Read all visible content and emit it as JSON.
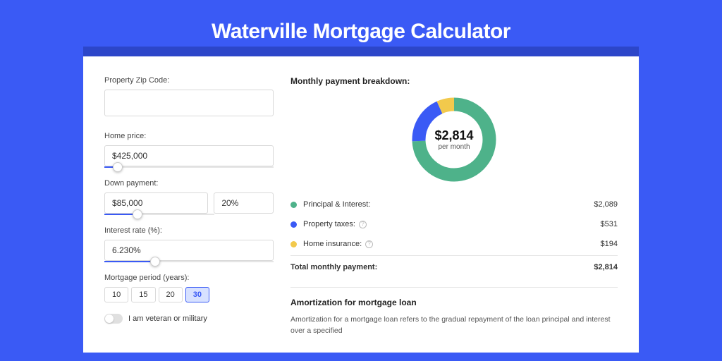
{
  "page": {
    "title": "Waterville Mortgage Calculator"
  },
  "form": {
    "zip": {
      "label": "Property Zip Code:",
      "value": ""
    },
    "home_price": {
      "label": "Home price:",
      "value": "$425,000",
      "slider_pct": 8
    },
    "down_payment": {
      "label": "Down payment:",
      "amount": "$85,000",
      "percent": "20%",
      "slider_pct": 20
    },
    "interest_rate": {
      "label": "Interest rate (%):",
      "value": "6.230%",
      "slider_pct": 30
    },
    "mortgage_period": {
      "label": "Mortgage period (years):",
      "options": [
        "10",
        "15",
        "20",
        "30"
      ],
      "active": "30"
    },
    "veteran": {
      "label": "I am veteran or military",
      "on": false
    }
  },
  "breakdown": {
    "title": "Monthly payment breakdown:",
    "center_amount": "$2,814",
    "center_sub": "per month",
    "items": [
      {
        "label": "Principal & Interest:",
        "value": "$2,089",
        "amount": 2089,
        "color": "#4eb28a",
        "info": false
      },
      {
        "label": "Property taxes:",
        "value": "$531",
        "amount": 531,
        "color": "#3a5af5",
        "info": true
      },
      {
        "label": "Home insurance:",
        "value": "$194",
        "amount": 194,
        "color": "#f2c94c",
        "info": true
      }
    ],
    "total": {
      "label": "Total monthly payment:",
      "value": "$2,814",
      "amount": 2814
    }
  },
  "amortization": {
    "title": "Amortization for mortgage loan",
    "body": "Amortization for a mortgage loan refers to the gradual repayment of the loan principal and interest over a specified"
  },
  "chart_data": {
    "type": "pie",
    "title": "Monthly payment breakdown",
    "categories": [
      "Principal & Interest",
      "Property taxes",
      "Home insurance"
    ],
    "values": [
      2089,
      531,
      194
    ],
    "colors": [
      "#4eb28a",
      "#3a5af5",
      "#f2c94c"
    ],
    "total": 2814,
    "center_label": "$2,814 per month"
  }
}
